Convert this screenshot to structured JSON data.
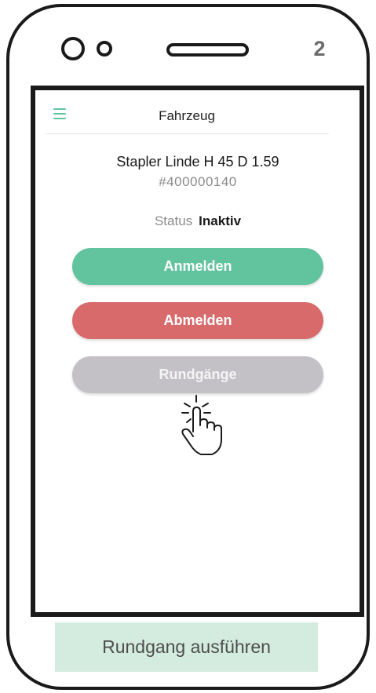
{
  "device": {
    "step_number": "2"
  },
  "app": {
    "header_title": "Fahrzeug",
    "menu_icon": "hamburger-menu-icon",
    "accent_color": "#5fc7a0"
  },
  "vehicle": {
    "name": "Stapler Linde H 45 D 1.59",
    "id": "#400000140",
    "status_label": "Status",
    "status_value": "Inaktiv"
  },
  "actions": {
    "login_label": "Anmelden",
    "login_color": "#62c39f",
    "logout_label": "Abmelden",
    "logout_color": "#d86a6c",
    "rounds_label": "Rundgänge",
    "rounds_color": "#c3c1c6"
  },
  "pointer_icon": "tap-hand-icon",
  "caption": {
    "text": "Rundgang ausführen"
  }
}
